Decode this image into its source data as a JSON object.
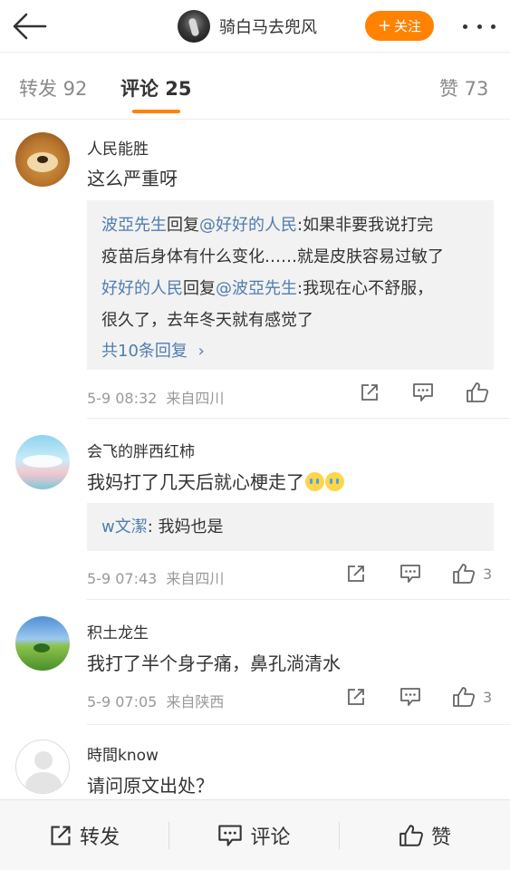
{
  "header": {
    "author_name": "骑白马去兜风",
    "follow_label": "关注",
    "follow_plus": "+"
  },
  "tabs": [
    {
      "label": "转发 92"
    },
    {
      "label": "评论 25"
    },
    {
      "label": "赞 73"
    }
  ],
  "comments": [
    {
      "name": "人民能胜",
      "text": "这么严重呀",
      "replies": [
        {
          "from": "波亞先生",
          "mid": "回复",
          "to": "@好好的人民",
          "body1": ":如果非要我说打完",
          "body2": "疫苗后身体有什么变化……就是皮肤容易过敏了"
        },
        {
          "from": "好好的人民",
          "mid": "回复",
          "to": "@波亞先生",
          "body1": ":我现在心不舒服，",
          "body2": "很久了，去年冬天就有感觉了"
        }
      ],
      "more_replies": "共10条回复",
      "more_arrow": "›",
      "time": "5-9 08:32",
      "source": "来自四川",
      "likes": ""
    },
    {
      "name": "会飞的胖西红柿",
      "text": "我妈打了几天后就心梗走了",
      "reply": {
        "from": "w文潔",
        "body": ": 我妈也是"
      },
      "time": "5-9 07:43",
      "source": "来自四川",
      "likes": "3"
    },
    {
      "name": "积土龙生",
      "text": "我打了半个身子痛，鼻孔淌清水",
      "time": "5-9 07:05",
      "source": "来自陕西",
      "likes": "3"
    },
    {
      "name": "時間know",
      "text": "请问原文出处？"
    }
  ],
  "bottom_bar": {
    "repost": "转发",
    "comment": "评论",
    "like": "赞"
  },
  "colors": {
    "accent": "#ff8200",
    "link": "#507daf",
    "meta": "#999999"
  },
  "icons": [
    "back-arrow-icon",
    "more-dots-icon",
    "share-icon",
    "comment-icon",
    "thumbs-up-icon",
    "crying-emoji-icon"
  ]
}
